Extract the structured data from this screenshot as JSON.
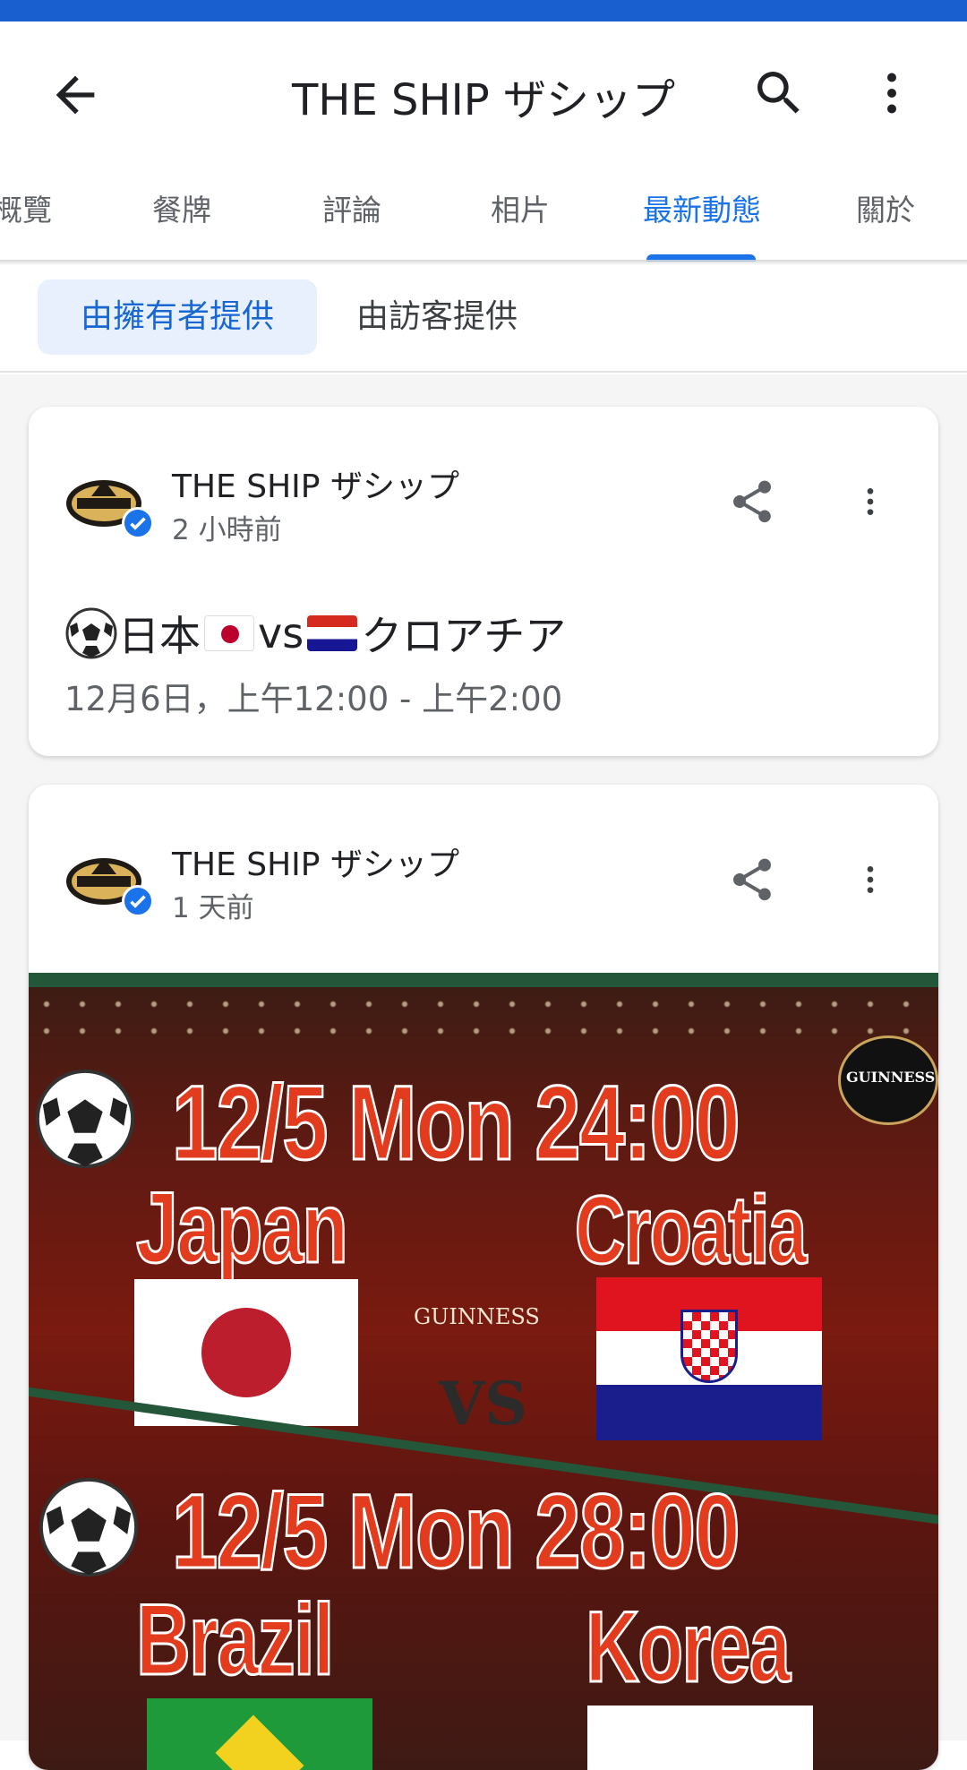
{
  "app_bar": {
    "title": "THE SHIP ザシップ",
    "back_icon": "arrow-back-icon",
    "search_icon": "search-icon",
    "more_icon": "more-vert-icon"
  },
  "tabs": [
    {
      "label": "概覽",
      "active": false
    },
    {
      "label": "餐牌",
      "active": false
    },
    {
      "label": "評論",
      "active": false
    },
    {
      "label": "相片",
      "active": false
    },
    {
      "label": "最新動態",
      "active": true
    },
    {
      "label": "關於",
      "active": false
    }
  ],
  "filters": {
    "owner": "由擁有者提供",
    "visitor": "由訪客提供"
  },
  "posts": [
    {
      "author": "THE SHIP ザシップ",
      "time": "2 小時前",
      "title_parts": [
        "日本",
        "vs",
        "クロアチア"
      ],
      "subtitle": "12月6日，上午12:00 - 上午2:00"
    },
    {
      "author": "THE SHIP ザシップ",
      "time": "1 天前",
      "image": {
        "line1": "12/5 Mon 24:00",
        "team1": "Japan",
        "team2": "Croatia",
        "vs": "VS",
        "poster": "GUINNESS",
        "line2": "12/5 Mon 28:00",
        "team3": "Brazil",
        "team4": "Korea",
        "sign": "GUINNESS"
      }
    }
  ],
  "colors": {
    "accent": "#1a73e8",
    "chip_bg": "#e8f0fe",
    "status_bar": "#1a5fd0",
    "promo_red": "#e23b1e"
  }
}
